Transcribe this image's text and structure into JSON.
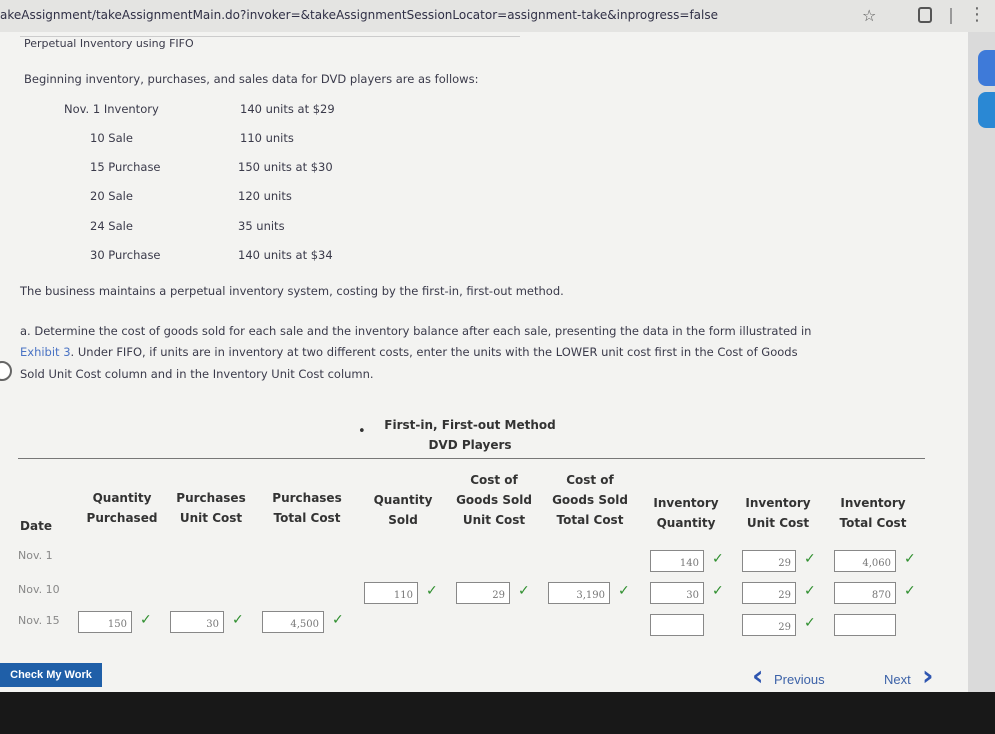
{
  "browser": {
    "url": "akeAssignment/takeAssignmentMain.do?invoker=&takeAssignmentSessionLocator=assignment-take&inprogress=false"
  },
  "page": {
    "title": "Perpetual Inventory using FIFO",
    "intro": "Beginning inventory, purchases, and sales data for DVD players are as follows:",
    "data_rows": [
      {
        "date": "Nov. 1  Inventory",
        "value": "140 units at $29"
      },
      {
        "date": "10  Sale",
        "value": "110 units"
      },
      {
        "date": "15  Purchase",
        "value": "150 units at $30"
      },
      {
        "date": "20  Sale",
        "value": "120 units"
      },
      {
        "date": "24  Sale",
        "value": "35 units"
      },
      {
        "date": "30  Purchase",
        "value": "140 units at $34"
      }
    ],
    "business_note": "The business maintains a perpetual inventory system, costing by the first-in, first-out method.",
    "instructions": {
      "line1": "a.  Determine the cost of goods sold for each sale and the inventory balance after each sale, presenting the data in the form illustrated in",
      "exhibit_link": "Exhibit 3",
      "line2_rest": ". Under FIFO, if units are in inventory at two different costs, enter the units with the LOWER unit cost first in the Cost of Goods",
      "line3": "Sold Unit Cost column and in the Inventory Unit Cost column."
    }
  },
  "table": {
    "title1": "First-in, First-out Method",
    "title2": "DVD Players",
    "headers": {
      "date": "Date",
      "qty_purchased": [
        "Quantity",
        "Purchased"
      ],
      "purchases_unit_cost": [
        "Purchases",
        "Unit Cost"
      ],
      "purchases_total_cost": [
        "Purchases",
        "Total Cost"
      ],
      "qty_sold": [
        "Quantity",
        "Sold"
      ],
      "cogs_unit_cost": [
        "Cost of",
        "Goods Sold",
        "Unit Cost"
      ],
      "cogs_total_cost": [
        "Cost of",
        "Goods Sold",
        "Total Cost"
      ],
      "inv_qty": [
        "Inventory",
        "Quantity"
      ],
      "inv_unit_cost": [
        "Inventory",
        "Unit Cost"
      ],
      "inv_total_cost": [
        "Inventory",
        "Total Cost"
      ]
    },
    "rows": {
      "nov1": {
        "date": "Nov. 1",
        "inv_qty": "140",
        "inv_unit_cost": "29",
        "inv_total_cost": "4,060"
      },
      "nov10": {
        "date": "Nov. 10",
        "qty_sold": "110",
        "cogs_unit_cost": "29",
        "cogs_total_cost": "3,190",
        "inv_qty": "30",
        "inv_unit_cost": "29",
        "inv_total_cost": "870"
      },
      "nov15": {
        "date": "Nov. 15",
        "qty_purchased": "150",
        "purchases_unit_cost": "30",
        "purchases_total_cost": "4,500",
        "inv_qty": "",
        "inv_unit_cost": "29",
        "inv_total_cost": ""
      }
    },
    "check_mark": "✓"
  },
  "footer": {
    "check_my_work": "Check My Work",
    "previous": "Previous",
    "next": "Next"
  }
}
